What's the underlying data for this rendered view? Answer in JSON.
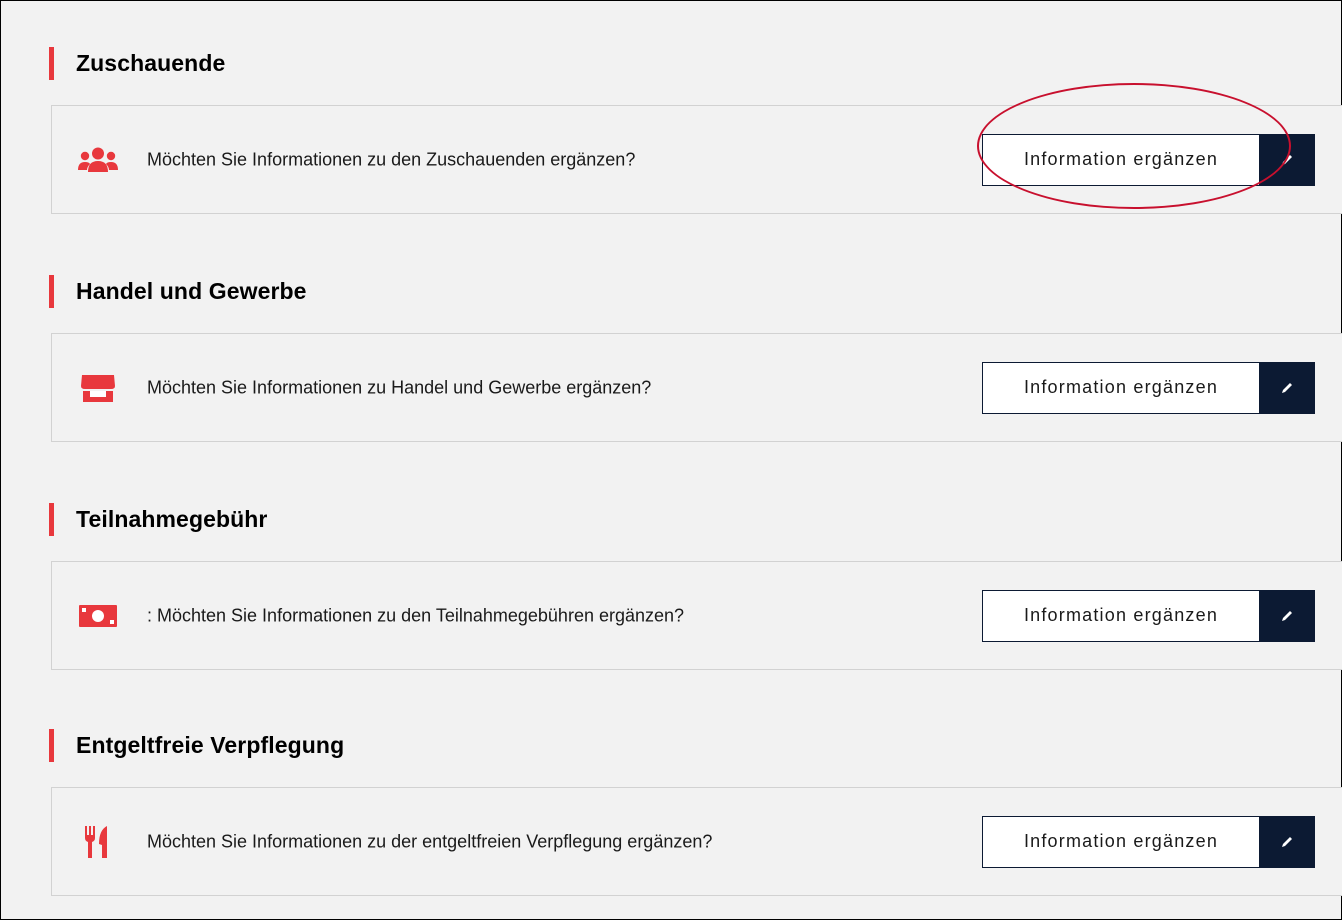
{
  "accent_color": "#e8383d",
  "button_dark_color": "#0c1a33",
  "annotation_color": "#c8102e",
  "sections": [
    {
      "title": "Zuschauende",
      "icon": "users-group-icon",
      "question": "Möchten Sie Informationen zu den Zuschauenden ergänzen?",
      "button_label": "Information ergänzen",
      "highlighted": true
    },
    {
      "title": "Handel und Gewerbe",
      "icon": "store-icon",
      "question": "Möchten Sie Informationen zu Handel und Gewerbe ergänzen?",
      "button_label": "Information ergänzen",
      "highlighted": false
    },
    {
      "title": "Teilnahmegebühr",
      "icon": "money-bill-icon",
      "question": ": Möchten Sie Informationen zu den Teilnahmegebühren ergänzen?",
      "button_label": "Information ergänzen",
      "highlighted": false
    },
    {
      "title": "Entgeltfreie Verpflegung",
      "icon": "utensils-icon",
      "question": "Möchten Sie Informationen zu der entgeltfreien Verpflegung ergänzen?",
      "button_label": "Information ergänzen",
      "highlighted": false
    }
  ]
}
